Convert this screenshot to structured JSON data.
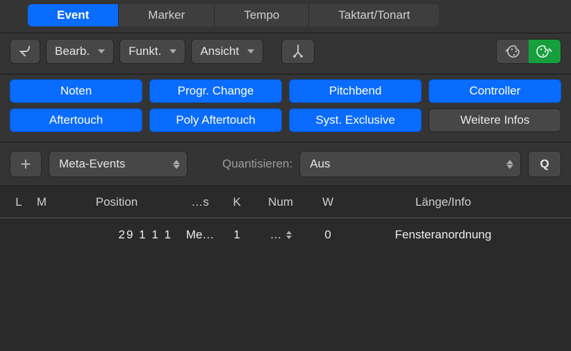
{
  "header": {
    "tabs": [
      {
        "label": "Event",
        "active": true
      },
      {
        "label": "Marker",
        "active": false
      },
      {
        "label": "Tempo",
        "active": false
      },
      {
        "label": "Taktart/Tonart",
        "active": false
      }
    ]
  },
  "toolbar": {
    "back_icon": "return-arrow-icon",
    "edit_label": "Bearb.",
    "funct_label": "Funkt.",
    "view_label": "Ansicht",
    "split_icon": "split-quantize-icon",
    "palette_dark_icon": "palette-icon",
    "palette_green_icon": "palette-icon"
  },
  "filters": {
    "row1": [
      "Noten",
      "Progr. Change",
      "Pitchbend",
      "Controller"
    ],
    "row2": [
      "Aftertouch",
      "Poly Aftertouch",
      "Syst. Exclusive",
      "Weitere Infos"
    ],
    "neutral_indices": [
      7
    ]
  },
  "subbar": {
    "add_icon": "+",
    "event_type_label": "Meta-Events",
    "quantize_label": "Quantisieren:",
    "quantize_value": "Aus",
    "q_button": "Q"
  },
  "table": {
    "columns": {
      "l": "L",
      "m": "M",
      "position": "Position",
      "s": "…s",
      "k": "K",
      "num": "Num",
      "w": "W",
      "length_info": "Länge/Info"
    },
    "rows": [
      {
        "l": "",
        "m": "",
        "position": "29  1  1       1",
        "s": "Me…",
        "k": "1",
        "num": "…",
        "w": "0",
        "length_info": "Fensteranordnung"
      }
    ]
  }
}
